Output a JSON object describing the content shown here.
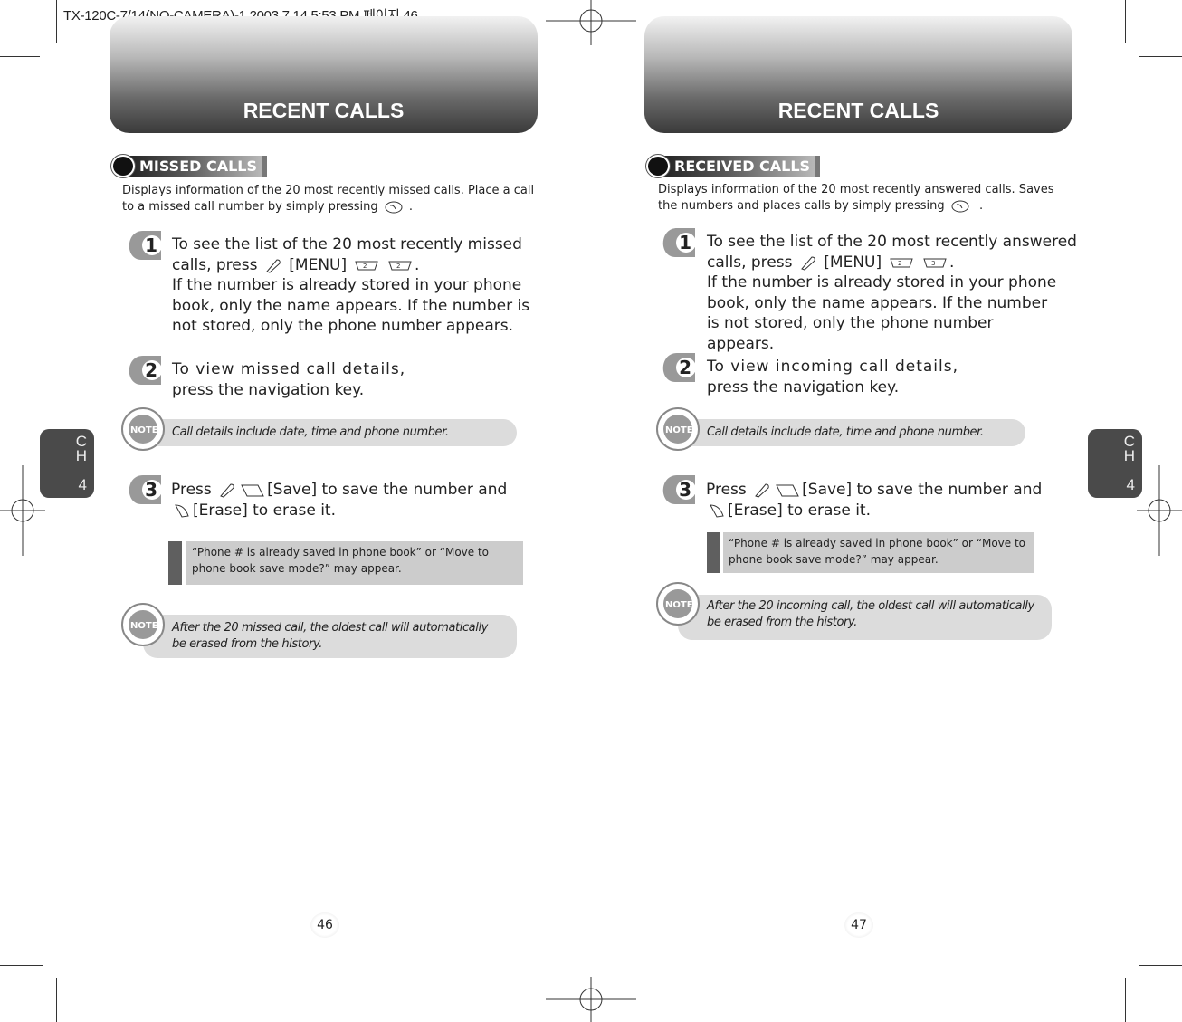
{
  "slug": "TX-120C-7/14(NO-CAMERA)-1  2003.7.14 5:53 PM 페이지 46",
  "pages": [
    {
      "header_title": "RECENT CALLS",
      "section_title": "MISSED CALLS",
      "description": "Displays information of the 20 most recently missed calls. Place a call to a missed call number by simply pressing",
      "steps": [
        {
          "number": "1",
          "line_a": "To see the list of the 20 most recently missed",
          "line_b_pre": "calls, press",
          "line_b_post": "[MENU]",
          "line_c": "If the number is already stored in your phone book, only the name appears. If the number is not stored, only the phone number appears."
        },
        {
          "number": "2",
          "text": "To view missed call details,",
          "text2": "press the navigation key."
        },
        {
          "number": "3",
          "pre": "Press",
          "save": "[Save] to save the number and",
          "erase": "[Erase] to erase it."
        }
      ],
      "note1": "Call details include date, time and phone number.",
      "quote": "“Phone # is already saved in phone book” or “Move to phone book save mode?” may appear.",
      "note2_a": "After the 20 missed call, the oldest call will automatically",
      "note2_b": "be erased from the history.",
      "chapter": {
        "c": "C",
        "h": "H",
        "n": "4"
      },
      "page_number": "46",
      "menu_keys": [
        "2abc",
        "2abc"
      ]
    },
    {
      "header_title": "RECENT CALLS",
      "section_title": "RECEIVED CALLS",
      "description": "Displays information of the 20 most recently answered calls. Saves the numbers and places calls by simply pressing",
      "steps": [
        {
          "number": "1",
          "line_a": "To see the list of the 20 most recently answered",
          "line_b_pre": "calls, press",
          "line_b_post": "[MENU]",
          "line_c": "If the number is already stored in your phone book, only the name appears. If the number is not stored, only the phone number appears."
        },
        {
          "number": "2",
          "text": "To view incoming call details,",
          "text2": "press the navigation key."
        },
        {
          "number": "3",
          "pre": "Press",
          "save": "[Save] to save the number and",
          "erase": "[Erase] to erase it."
        }
      ],
      "note1": "Call details include date, time and phone number.",
      "quote": "“Phone # is already saved in phone book” or “Move to phone book save mode?” may appear.",
      "note2_a": "After the 20 incoming call, the oldest call will automatically",
      "note2_b": "be erased from the history.",
      "chapter": {
        "c": "C",
        "h": "H",
        "n": "4"
      },
      "page_number": "47",
      "menu_keys": [
        "2abc",
        "3def"
      ]
    }
  ],
  "note_label": "NOTE"
}
